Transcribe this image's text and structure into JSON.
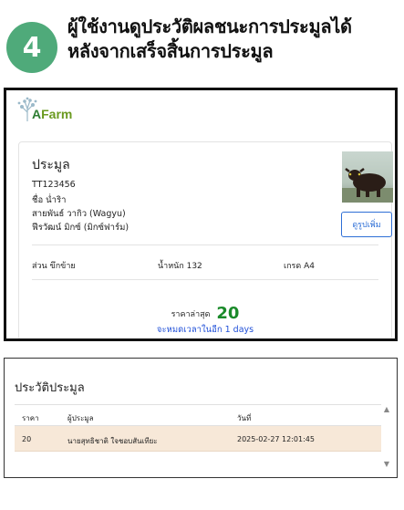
{
  "step": {
    "number": "4",
    "title_line1": "ผู้ใช้งานดูประวัติผลชนะการประมูลได้",
    "title_line2": "หลังจากเสร็จสิ้นการประมูล"
  },
  "logo": {
    "text_a": "A",
    "text_rest": "Farm"
  },
  "auction_card": {
    "title": "ประมูล",
    "code": "TT123456",
    "name": "ชื่อ น่ำริา",
    "breed": "สายพันธ์ วากิว (Wagyu)",
    "farm": "ฟีรวัฒน์ มิกซ์ (มิกซ์ฟาร์ม)",
    "more_button": "ดูรูปเพิ่ม",
    "meta": {
      "section": "ส่วน ขึกข้าย",
      "weight": "น้ำหนัก 132",
      "grade": "เกรด A4"
    },
    "min_price_label": "ราคาล่าสุด",
    "min_price_value": "20",
    "countdown": "จะหมดเวลาในอีก 1 days"
  },
  "history": {
    "title": "ประวัติประมูล",
    "columns": [
      "ราคา",
      "ผู้ประมูล",
      "วันที่"
    ],
    "rows": [
      {
        "price": "20",
        "bidder": "นายสุทธิชาติ ใจชอบสันเทียะ",
        "date": "2025-02-27 12:01:45"
      }
    ]
  },
  "colors": {
    "badge": "#4faa7a",
    "price_green": "#1a8a2a",
    "link_blue": "#1f4fd8",
    "row_highlight": "#f7e8d8"
  }
}
